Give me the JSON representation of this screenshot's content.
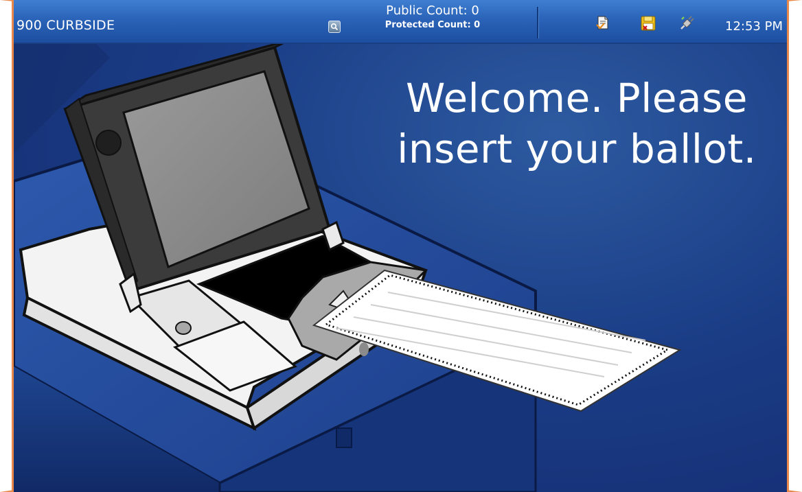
{
  "header": {
    "unit_name": "900 CURBSIDE",
    "public_count": "Public Count: 0",
    "protected_count": "Protected Count: 0",
    "time": "12:53 PM",
    "icons": [
      "search-icon",
      "report-icon",
      "memory-card-icon",
      "power-plug-icon"
    ]
  },
  "main": {
    "message": "Welcome. Please insert your ballot."
  },
  "colors": {
    "header_blue": "#2a63b8",
    "background_navy": "#1a3d86",
    "frame_orange": "#e8884a"
  }
}
